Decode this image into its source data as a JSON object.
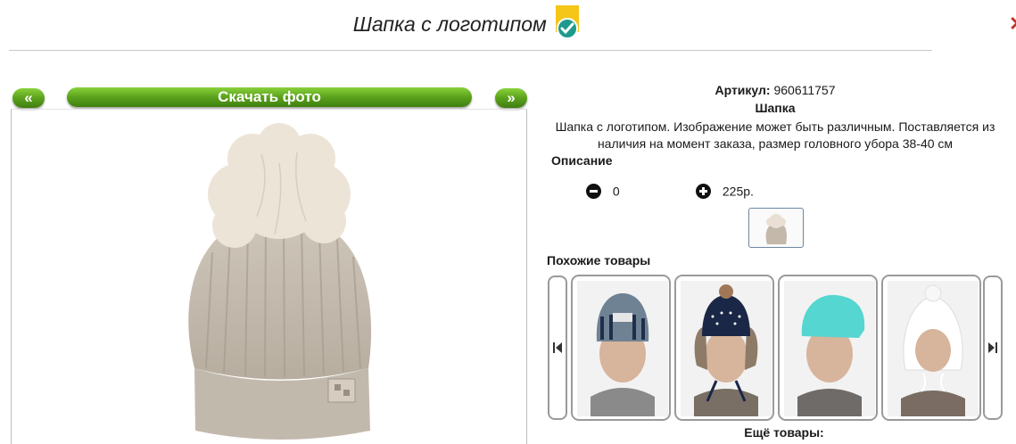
{
  "header": {
    "title": "Шапка с логотипом"
  },
  "gallery": {
    "prev_label": "«",
    "next_label": "»",
    "download_label": "Скачать фото"
  },
  "product": {
    "sku_label": "Артикул:",
    "sku_value": "960611757",
    "kind": "Шапка",
    "description": "Шапка с логотипом. Изображение может быть различным. Поставляется из наличия на момент заказа, размер головного убора 38-40 см",
    "description_heading": "Описание",
    "quantity": "0",
    "price": "225р."
  },
  "similar": {
    "title": "Похожие товары",
    "cards": [
      {
        "icon": "hat-striped-photo"
      },
      {
        "icon": "hat-pompom-earflaps-photo"
      },
      {
        "icon": "hat-turquoise-photo"
      },
      {
        "icon": "hat-white-ties-photo"
      }
    ]
  },
  "more": {
    "title": "Ещё товары:"
  },
  "colors": {
    "accent_green": "#5aa21c",
    "badge_yellow": "#f5c518",
    "badge_teal": "#1e9a8c",
    "close_red": "#c0392b"
  }
}
